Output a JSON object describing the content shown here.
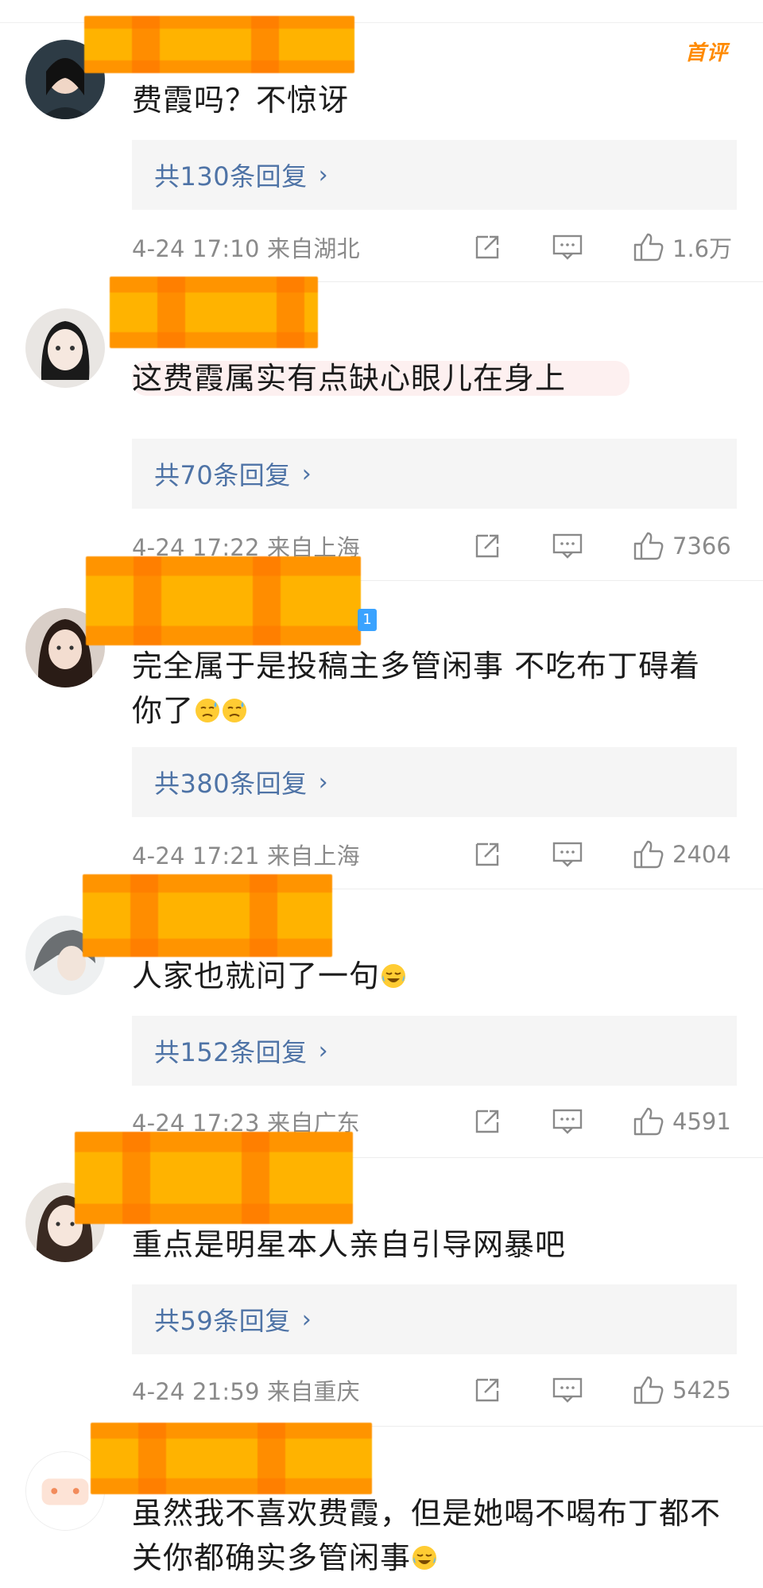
{
  "first_comment_badge": "首评",
  "comments": [
    {
      "text": "费霞吗？不惊讶",
      "replies_label": "共130条回复",
      "meta": "4-24 17:10 来自湖北",
      "likes": "1.6万"
    },
    {
      "text": "这费霞属实有点缺心眼儿在身上",
      "replies_label": "共70条回复",
      "meta": "4-24 17:22 来自上海",
      "likes": "7366"
    },
    {
      "text_line1": "完全属于是投稿主多管闲事 不吃布丁碍着",
      "text_line2": "你了",
      "replies_label": "共380条回复",
      "meta": "4-24 17:21 来自上海",
      "likes": "2404",
      "badge": "1"
    },
    {
      "text": "人家也就问了一句",
      "replies_label": "共152条回复",
      "meta": "4-24 17:23 来自广东",
      "likes": "4591"
    },
    {
      "text": "重点是明星本人亲自引导网暴吧",
      "replies_label": "共59条回复",
      "meta": "4-24 21:59 来自重庆",
      "likes": "5425"
    },
    {
      "text_line1": "虽然我不喜欢费霞，但是她喝不喝布丁都不",
      "text_line2": "关你都确实多管闲事"
    }
  ],
  "icons": {
    "share": "share-icon",
    "comment": "comment-icon",
    "like": "thumbs-up-icon",
    "chevron": "chevron-right-icon"
  },
  "colors": {
    "link_blue": "#4e73a6",
    "meta_gray": "#8a8a8a",
    "badge_orange": "#ff8a00",
    "redaction_orange": "#ffb300"
  }
}
